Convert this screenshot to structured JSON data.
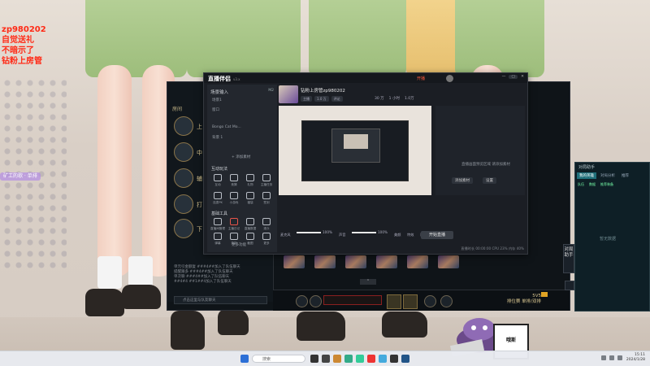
{
  "overlay": {
    "stream_lines": [
      "zp980202",
      "自觉送礼",
      "不暗示了",
      "钻粉上房管"
    ],
    "chip": "矿工的歌 · 单排"
  },
  "game_client": {
    "header": "房间",
    "rows": [
      "中",
      "辅",
      "打",
      "下"
    ],
    "first_row_hint": "上",
    "chat_lines": [
      "单元引金额复 ###4##加入了队伍聊天",
      "提醒跟多 ###4##加入了队伍聊天",
      "单次聊 ###4##加入了队伍聊天",
      "##4#4 ##1##4加入了队伍聊天"
    ],
    "chat_placeholder": "点击这里与队友聊天",
    "collapse": "⌃",
    "vs_label": "5V5",
    "mode_label": "排位赛 单排/双排",
    "side_handle": "对局助手"
  },
  "assistant": {
    "logo": "直播伴侣",
    "version": "v3.x",
    "live_label": "开播",
    "left_title": "场景输入",
    "left_scene": "场景1",
    "left_scene_tag": "M2",
    "lines": [
      "窗口",
      "Bongo Cat Mo...",
      "背景 1"
    ],
    "add_source": "+ 添加素材",
    "section_interact": "互动玩法",
    "section_tools": "基础工具",
    "tools_row1": [
      "互动",
      "竞猜",
      "礼物",
      "主播任务"
    ],
    "tools_row2": [
      "连麦PK",
      "小游戏",
      "福袋",
      "签到"
    ],
    "tools_row3": [
      "直播间管理",
      "主播日记",
      "直播数据",
      "观众"
    ],
    "tools_row4": [
      "弹幕",
      "录制",
      "截图",
      "更多"
    ],
    "more_tools": "更多功能",
    "room_title": "钻粉上房管zp980202",
    "tags": [
      "主播",
      "1.0 万",
      "评论"
    ],
    "stats": [
      "30 万",
      "1 小时",
      "1.0万"
    ],
    "pane_text": "直播画面预览区域\n请添加素材",
    "pane_btn1": "添加素材",
    "pane_btn2": "设置",
    "vol1_label": "麦克风",
    "vol1_value": "100%",
    "vol2_label": "声音",
    "vol2_value": "100%",
    "btn_labels": [
      "美颜",
      "特效",
      "设置"
    ],
    "go_live": "开始直播",
    "footer": "直播时长 00:00:00  CPU 23%  内存 40%"
  },
  "mate": {
    "title": "对局助手",
    "tabs": [
      "我的英雄",
      "对局分析",
      "推荐"
    ],
    "sub": [
      "队伍",
      "数据",
      "推荐装备"
    ],
    "empty": "暂无数据"
  },
  "taskbar": {
    "search": "搜索",
    "time": "15:11",
    "date": "2024/1/28"
  },
  "mascot": {
    "badge": "哦斯"
  },
  "colors": {
    "accent_red": "#ff2a16",
    "client_dark": "#0f1418",
    "live_orange": "#ff5a3c"
  }
}
